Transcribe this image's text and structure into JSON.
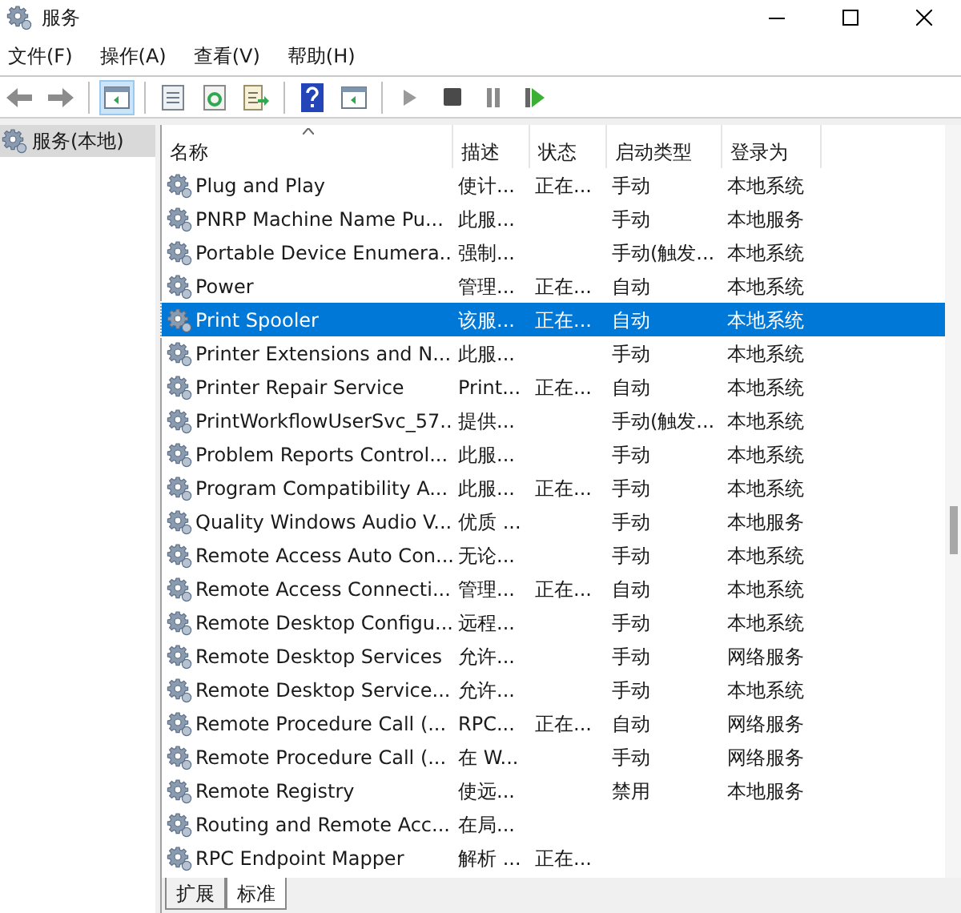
{
  "window": {
    "title": "服务"
  },
  "menu": [
    "文件(F)",
    "操作(A)",
    "查看(V)",
    "帮助(H)"
  ],
  "toolbar": [
    {
      "kind": "back",
      "selected": false
    },
    {
      "kind": "forward",
      "selected": false
    },
    {
      "kind": "sep"
    },
    {
      "kind": "console",
      "selected": true
    },
    {
      "kind": "sep"
    },
    {
      "kind": "properties",
      "selected": false
    },
    {
      "kind": "refresh",
      "selected": false
    },
    {
      "kind": "export",
      "selected": false
    },
    {
      "kind": "sep"
    },
    {
      "kind": "help",
      "selected": false
    },
    {
      "kind": "console2",
      "selected": false
    },
    {
      "kind": "sep"
    },
    {
      "kind": "play",
      "selected": false
    },
    {
      "kind": "stop",
      "selected": false
    },
    {
      "kind": "pause",
      "selected": false
    },
    {
      "kind": "resume",
      "selected": false
    }
  ],
  "tree": [
    {
      "label": "服务(本地)",
      "selected": true
    }
  ],
  "table": {
    "columns": [
      "名称",
      "描述",
      "状态",
      "启动类型",
      "登录为"
    ],
    "rows": [
      {
        "name": "Plug and Play",
        "desc": "使计...",
        "status": "正在...",
        "startup": "手动",
        "logon": "本地系统",
        "selected": false
      },
      {
        "name": "PNRP Machine Name Pu...",
        "desc": "此服...",
        "startup": "手动",
        "logon": "本地服务",
        "selected": false
      },
      {
        "name": "Portable Device Enumera...",
        "desc": "强制...",
        "startup": "手动(触发...",
        "logon": "本地系统",
        "selected": false
      },
      {
        "name": "Power",
        "desc": "管理...",
        "status": "正在...",
        "startup": "自动",
        "logon": "本地系统",
        "selected": false
      },
      {
        "name": "Print Spooler",
        "desc": "该服...",
        "status": "正在...",
        "startup": "自动",
        "logon": "本地系统",
        "selected": true
      },
      {
        "name": "Printer Extensions and N...",
        "desc": "此服...",
        "startup": "手动",
        "logon": "本地系统",
        "selected": false
      },
      {
        "name": "Printer Repair Service",
        "desc": "Print...",
        "status": "正在...",
        "startup": "自动",
        "logon": "本地系统",
        "selected": false
      },
      {
        "name": "PrintWorkflowUserSvc_57...",
        "desc": "提供...",
        "startup": "手动(触发...",
        "logon": "本地系统",
        "selected": false
      },
      {
        "name": "Problem Reports Control...",
        "desc": "此服...",
        "startup": "手动",
        "logon": "本地系统",
        "selected": false
      },
      {
        "name": "Program Compatibility A...",
        "desc": "此服...",
        "status": "正在...",
        "startup": "手动",
        "logon": "本地系统",
        "selected": false
      },
      {
        "name": "Quality Windows Audio V...",
        "desc": "优质 ...",
        "startup": "手动",
        "logon": "本地服务",
        "selected": false
      },
      {
        "name": "Remote Access Auto Con...",
        "desc": "无论...",
        "startup": "手动",
        "logon": "本地系统",
        "selected": false
      },
      {
        "name": "Remote Access Connecti...",
        "desc": "管理...",
        "status": "正在...",
        "startup": "自动",
        "logon": "本地系统",
        "selected": false
      },
      {
        "name": "Remote Desktop Configu...",
        "desc": "远程...",
        "startup": "手动",
        "logon": "本地系统",
        "selected": false
      },
      {
        "name": "Remote Desktop Services",
        "desc": "允许...",
        "startup": "手动",
        "logon": "网络服务",
        "selected": false
      },
      {
        "name": "Remote Desktop Service...",
        "desc": "允许...",
        "startup": "手动",
        "logon": "本地系统",
        "selected": false
      },
      {
        "name": "Remote Procedure Call (...",
        "desc": "RPC...",
        "status": "正在...",
        "startup": "自动",
        "logon": "网络服务",
        "selected": false
      },
      {
        "name": "Remote Procedure Call (...",
        "desc": "在 W...",
        "startup": "手动",
        "logon": "网络服务",
        "selected": false
      },
      {
        "name": "Remote Registry",
        "desc": "使远...",
        "startup": "禁用",
        "logon": "本地服务",
        "selected": false
      },
      {
        "name": "Routing and Remote Acc...",
        "desc": "在局...",
        "selected": false
      },
      {
        "name": "RPC Endpoint Mapper",
        "desc": "解析 ...",
        "status": "正在...",
        "selected": false
      }
    ]
  },
  "tabs": [
    {
      "label": "扩展",
      "selected": false
    },
    {
      "label": "标准",
      "selected": true
    }
  ]
}
